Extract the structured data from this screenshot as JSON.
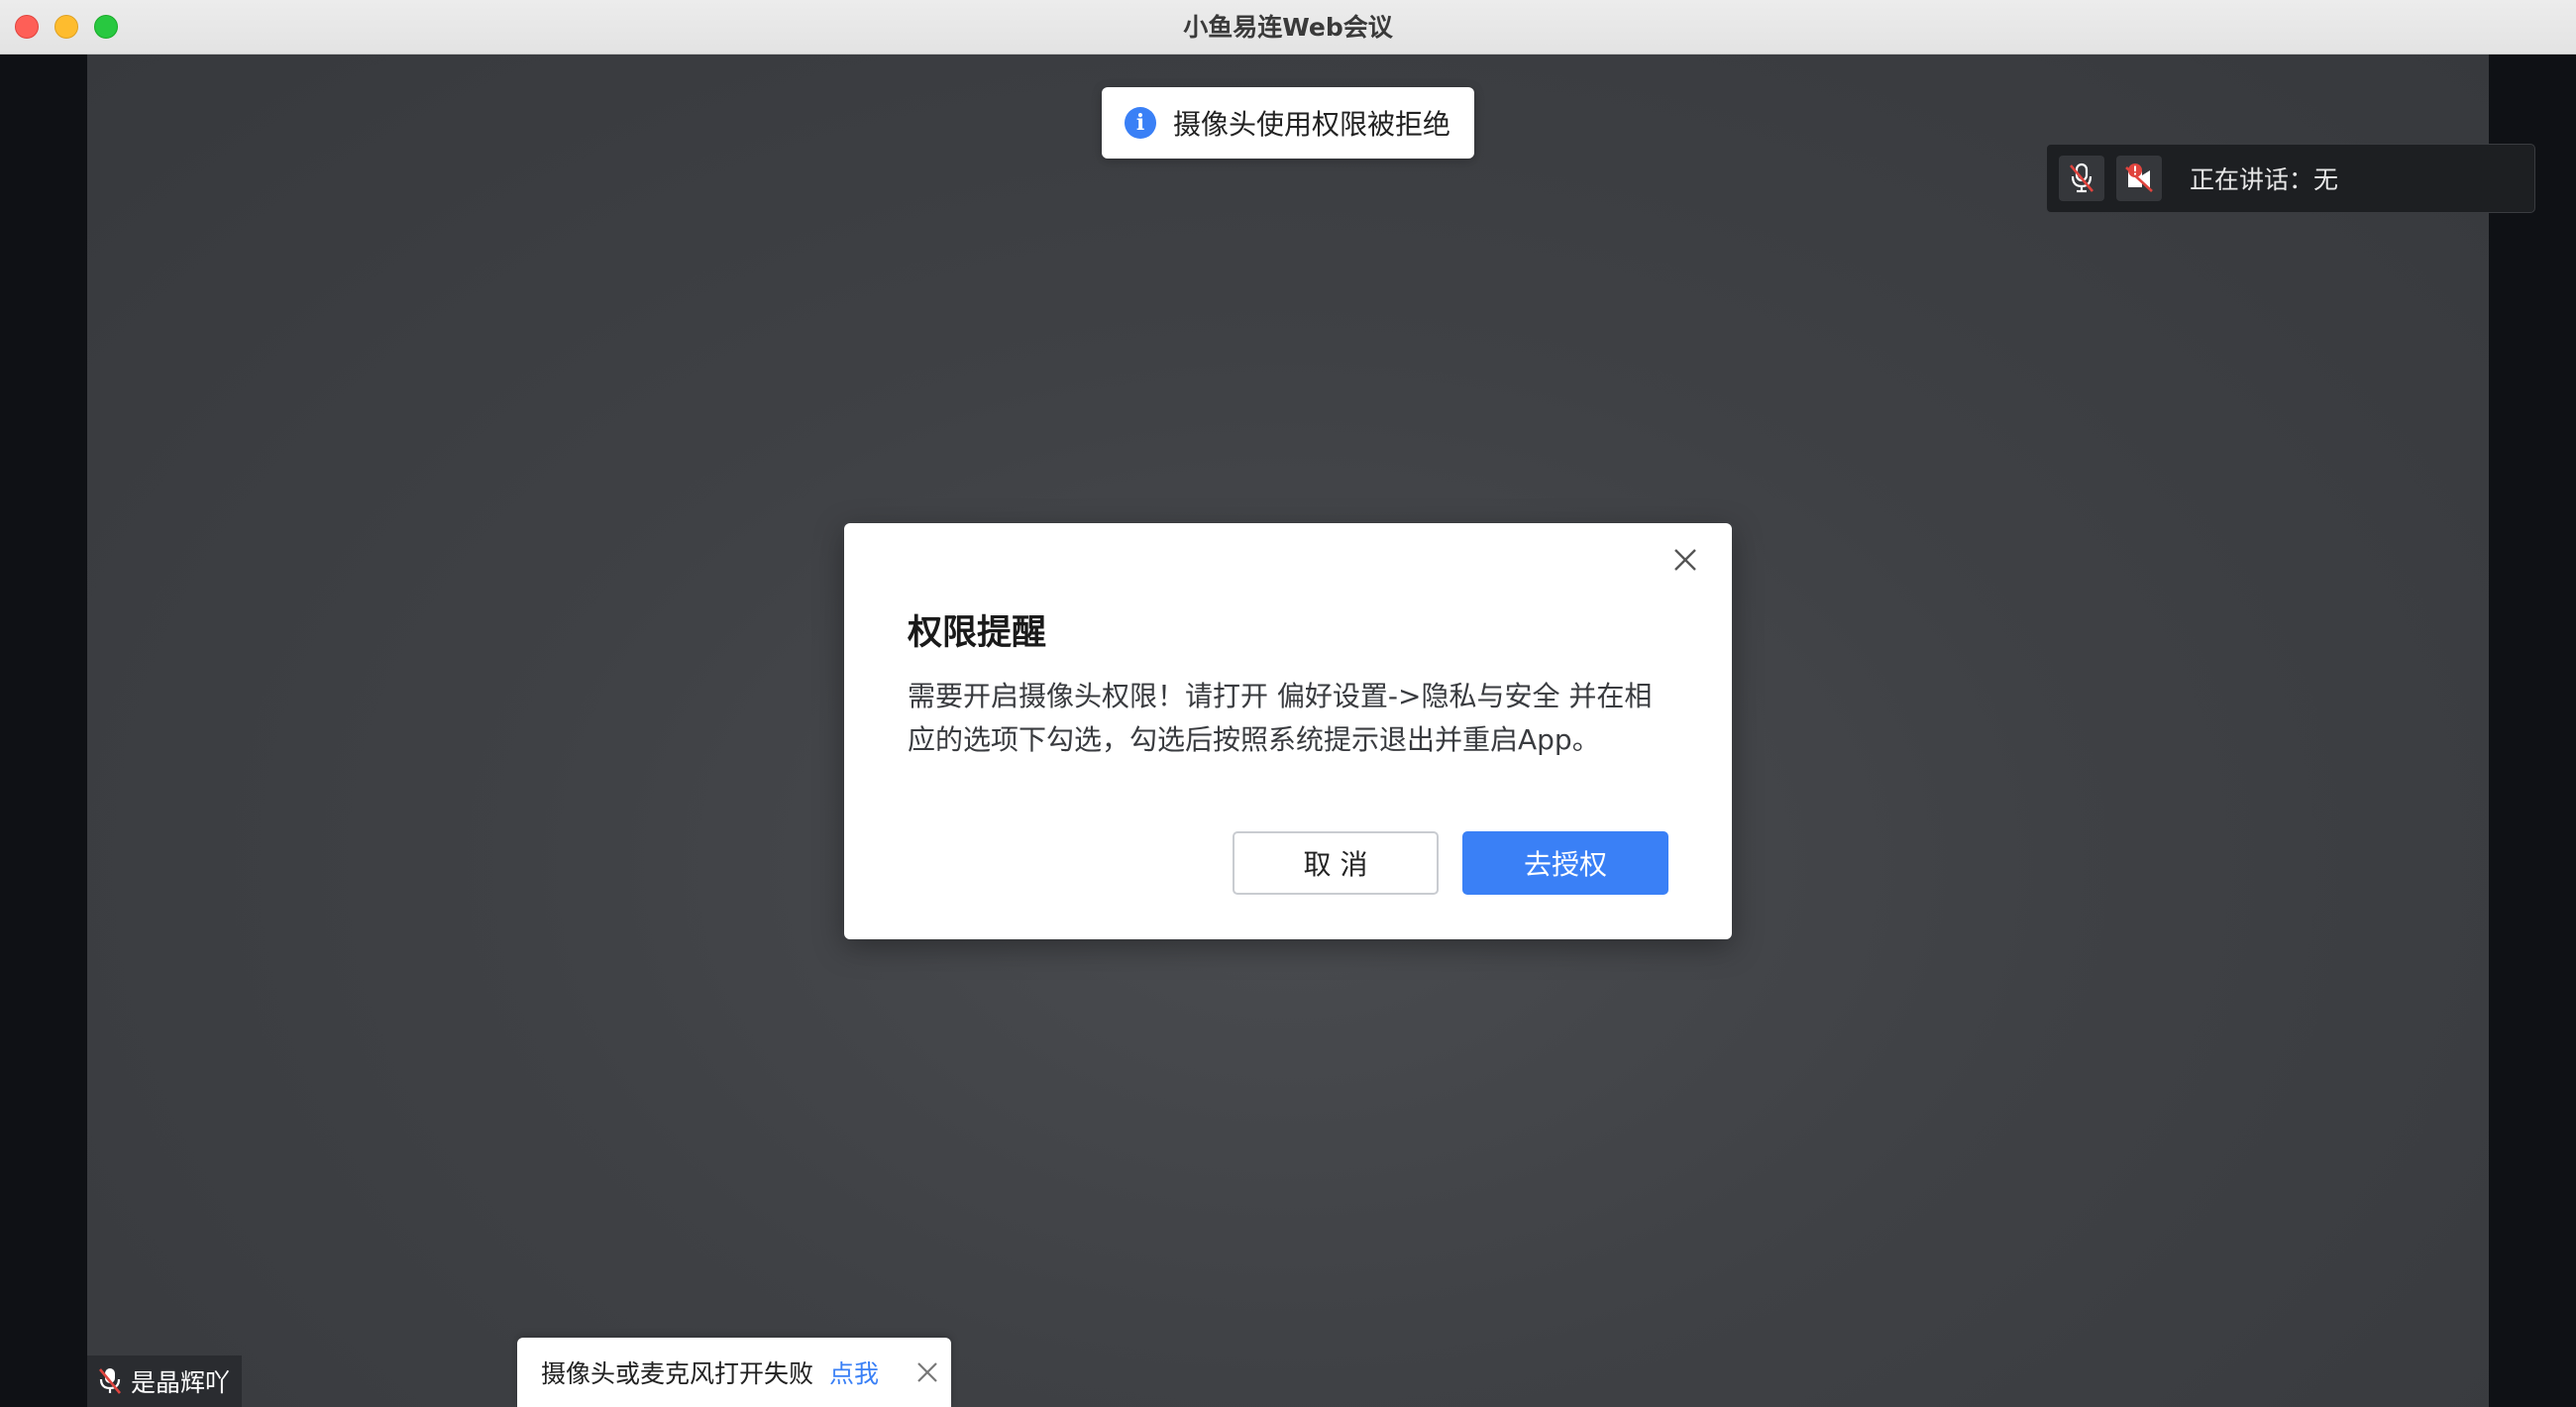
{
  "window": {
    "title": "小鱼易连Web会议"
  },
  "notification_top": {
    "icon": "info-icon",
    "text": "摄像头使用权限被拒绝"
  },
  "speaker_panel": {
    "mic_status_icon": "mic-muted-icon",
    "camera_status_icon": "camera-error-icon",
    "label": "正在讲话：无"
  },
  "dialog": {
    "title": "权限提醒",
    "body": "需要开启摄像头权限！请打开 偏好设置->隐私与安全 并在相应的选项下勾选，勾选后按照系统提示退出并重启App。",
    "cancel_label": "取 消",
    "confirm_label": "去授权"
  },
  "participant": {
    "name": "是晶辉吖",
    "mic_icon": "mic-muted-icon"
  },
  "notification_bottom": {
    "text": "摄像头或麦克风打开失败",
    "link_label": "点我"
  },
  "colors": {
    "accent": "#3a80f6",
    "stage_bg": "#3f4145",
    "muted_red": "#e0443e"
  }
}
